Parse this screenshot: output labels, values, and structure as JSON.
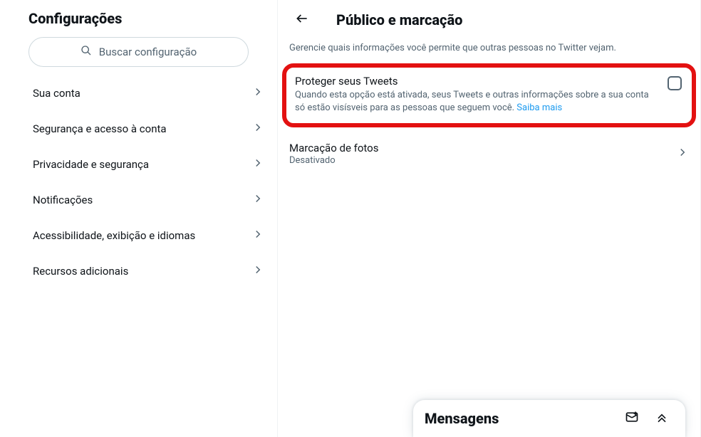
{
  "sidebar": {
    "title": "Configurações",
    "search_placeholder": "Buscar configuração",
    "items": [
      {
        "label": "Sua conta"
      },
      {
        "label": "Segurança e acesso à conta"
      },
      {
        "label": "Privacidade e segurança"
      },
      {
        "label": "Notificações"
      },
      {
        "label": "Acessibilidade, exibição e idiomas"
      },
      {
        "label": "Recursos adicionais"
      }
    ]
  },
  "content": {
    "title": "Público e marcação",
    "subtitle": "Gerencie quais informações você permite que outras pessoas no Twitter vejam.",
    "protect": {
      "title": "Proteger seus Tweets",
      "desc": "Quando esta opção está ativada, seus Tweets e outras informações sobre a sua conta só estão visísveis para as pessoas que seguem você. ",
      "learn_more": "Saiba mais"
    },
    "photo_tagging": {
      "title": "Marcação de fotos",
      "status": "Desativado"
    }
  },
  "messages": {
    "title": "Mensagens"
  }
}
